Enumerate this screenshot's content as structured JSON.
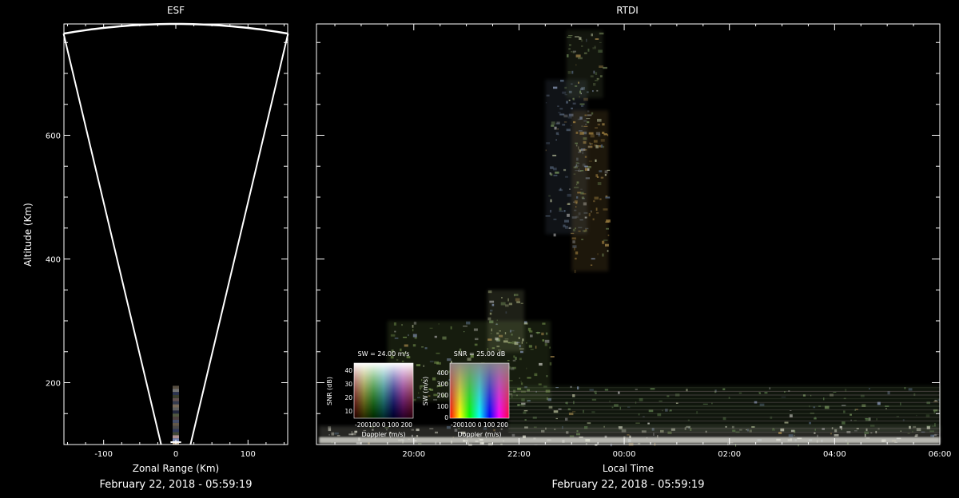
{
  "chart_data": [
    {
      "type": "scatter",
      "title": "ESF",
      "xlabel": "Zonal Range (Km)",
      "ylabel": "Altitude (Km)",
      "xlim": [
        -155,
        155
      ],
      "ylim": [
        100,
        780
      ],
      "x_ticks": [
        -100,
        0,
        100
      ],
      "y_ticks": [
        200,
        400,
        600
      ],
      "fan": {
        "apex_altitude": 0,
        "half_angle_deg": 11.5,
        "max_range": 780
      },
      "echo_x": 0,
      "echo_alt_range": [
        100,
        195
      ],
      "footer": "February 22, 2018 - 05:59:19"
    },
    {
      "type": "heatmap",
      "title": "RTDI",
      "xlabel": "Local Time",
      "ylabel": "",
      "x_ticks": [
        "20:00",
        "22:00",
        "00:00",
        "02:00",
        "04:00",
        "06:00"
      ],
      "x_tick_hours": [
        20,
        22,
        24,
        26,
        28,
        30
      ],
      "xlim_hours": [
        18.15,
        30
      ],
      "ylim": [
        100,
        780
      ],
      "y_ticks": [
        200,
        400,
        600
      ],
      "footer": "February 22, 2018 - 05:59:19",
      "echo_regions": [
        {
          "t": [
            18.2,
            30
          ],
          "alt": [
            100,
            130
          ],
          "tone": "#d8d8c8"
        },
        {
          "t": [
            21.8,
            30
          ],
          "alt": [
            120,
            195
          ],
          "tone": "#5a7a4a"
        },
        {
          "t": [
            19.5,
            22.6
          ],
          "alt": [
            170,
            300
          ],
          "tone": "#7a9a50"
        },
        {
          "t": [
            21.4,
            22.1
          ],
          "alt": [
            250,
            350
          ],
          "tone": "#a8b080"
        },
        {
          "t": [
            22.5,
            23.3
          ],
          "alt": [
            440,
            690
          ],
          "tone": "#5a6a80"
        },
        {
          "t": [
            23.0,
            23.7
          ],
          "alt": [
            380,
            640
          ],
          "tone": "#a08040"
        },
        {
          "t": [
            22.9,
            23.6
          ],
          "alt": [
            660,
            770
          ],
          "tone": "#6a7a50"
        }
      ],
      "legends": [
        {
          "label": "SW = 24.00 m/s",
          "ylabel": "SNR (dB)",
          "xlabel": "Doppler (m/s)",
          "y_ticks": [
            "40",
            "30",
            "20",
            "10"
          ],
          "x_ticks": "-200100 0 100 200"
        },
        {
          "label": "SNR = 25.00 dB",
          "ylabel": "SW (m/s)",
          "xlabel": "Doppler (m/s)",
          "y_ticks": [
            "400",
            "300",
            "200",
            "100",
            "0"
          ],
          "x_ticks": "-200100  0  100 200"
        }
      ]
    }
  ]
}
